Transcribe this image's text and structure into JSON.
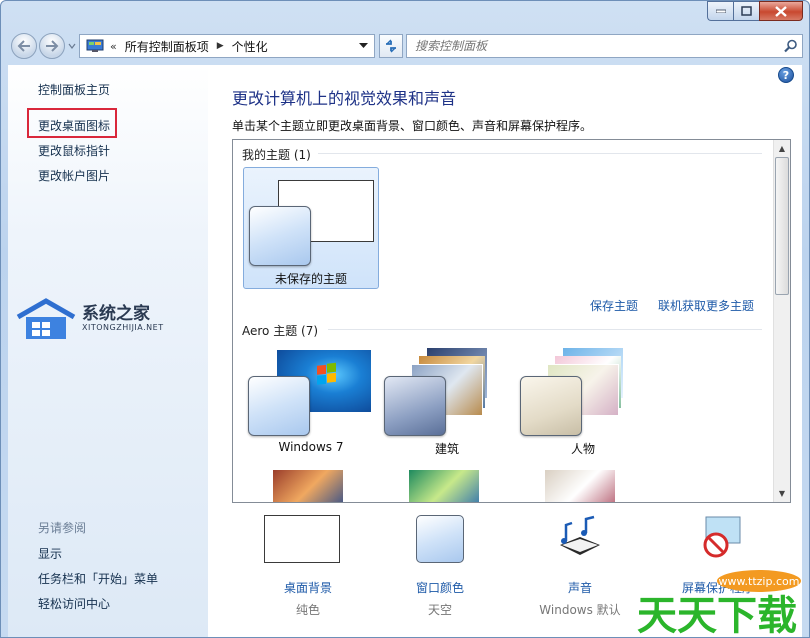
{
  "window": {
    "address_crumbs": [
      "所有控制面板项",
      "个性化"
    ],
    "search_placeholder": "搜索控制面板"
  },
  "sidebar": {
    "links": [
      "控制面板主页",
      "更改桌面图标",
      "更改鼠标指针",
      "更改帐户图片"
    ],
    "see_also_heading": "另请参阅",
    "see_also_links": [
      "显示",
      "任务栏和「开始」菜单",
      "轻松访问中心"
    ]
  },
  "main": {
    "title": "更改计算机上的视觉效果和声音",
    "subtitle": "单击某个主题立即更改桌面背景、窗口颜色、声音和屏幕保护程序。",
    "my_themes": {
      "heading": "我的主题 (1)",
      "items": [
        {
          "label": "未保存的主题"
        }
      ]
    },
    "save_theme_link": "保存主题",
    "get_more_link": "联机获取更多主题",
    "aero_themes": {
      "heading": "Aero 主题 (7)",
      "items": [
        {
          "label": "Windows 7"
        },
        {
          "label": "建筑"
        },
        {
          "label": "人物"
        }
      ]
    }
  },
  "bottom": [
    {
      "label": "桌面背景",
      "sub": "纯色"
    },
    {
      "label": "窗口颜色",
      "sub": "天空"
    },
    {
      "label": "声音",
      "sub": "Windows 默认"
    },
    {
      "label": "屏幕保护程序",
      "sub": ""
    }
  ],
  "watermark": {
    "title": "系统之家",
    "url": "XITONGZHIJIA.NET"
  },
  "brand": {
    "text": "天天下载",
    "url": "www.ttzip.com"
  },
  "colors": {
    "title": "#1e3287",
    "link": "#1e5aa8",
    "highlight": "#d9273b"
  }
}
